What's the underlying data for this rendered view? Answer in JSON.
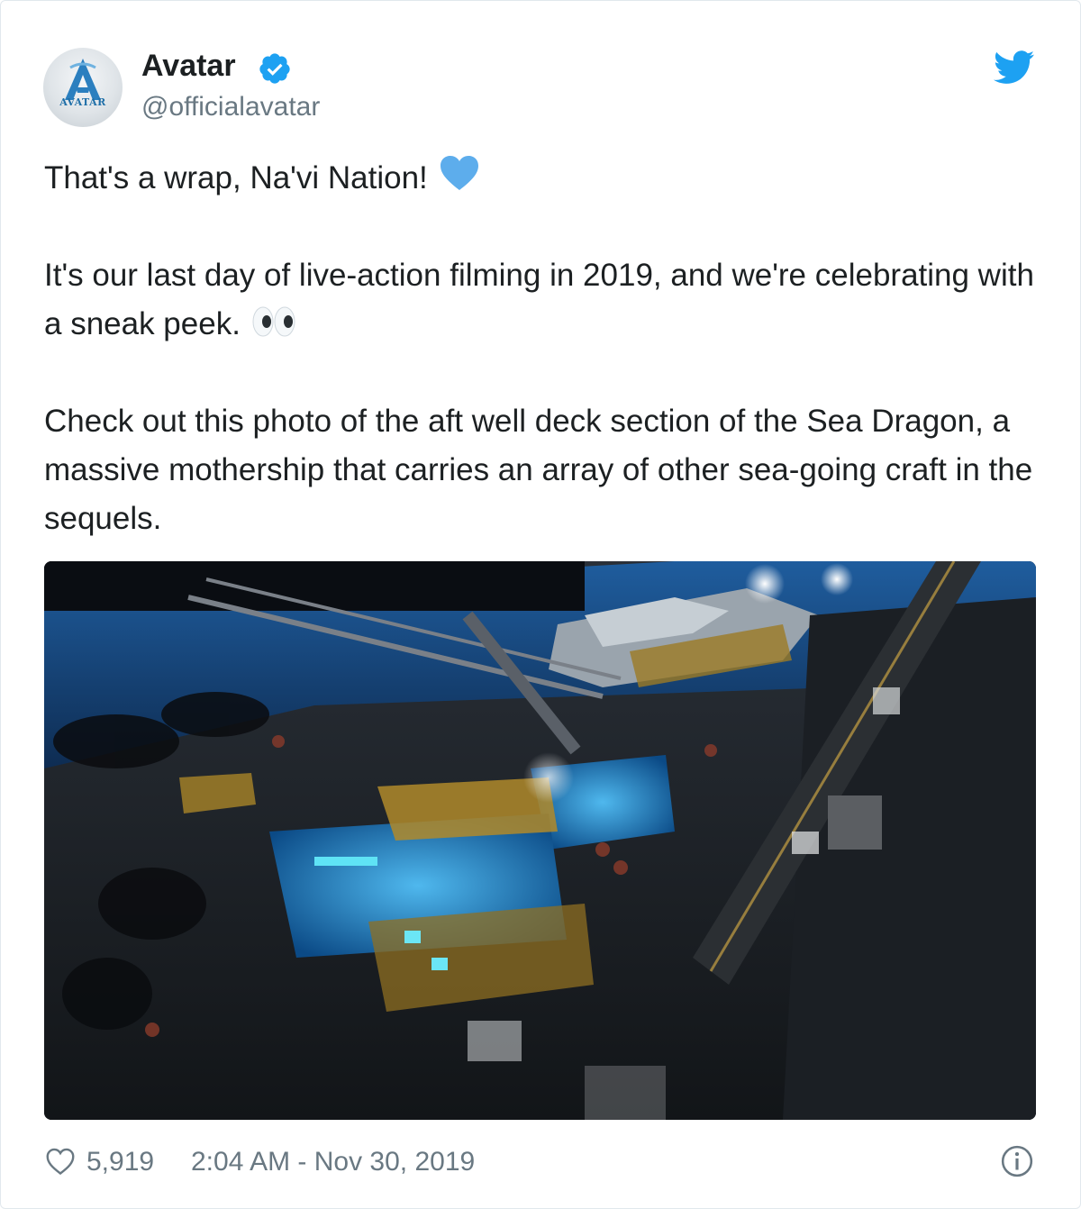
{
  "author": {
    "name": "Avatar",
    "handle": "@officialavatar",
    "logo_text": "AVATAR",
    "verified_icon": "verified-badge-icon",
    "verified_color": "#1da1f2"
  },
  "brand": {
    "icon": "twitter-bird-icon",
    "color": "#1da1f2"
  },
  "tweet": {
    "paragraphs": [
      "That's a wrap, Na'vi Nation!",
      "It's our last day of live-action filming in 2019, and we're celebrating with a sneak peek.",
      "Check out this photo of the aft well deck section of the Sea Dragon, a massive mothership that carries an array of other sea-going craft in the sequels."
    ],
    "emojis": [
      "blue-heart-icon",
      "eyes-icon"
    ]
  },
  "media": {
    "type": "photo",
    "subject": "film-set-photo"
  },
  "footer": {
    "like_icon": "heart-outline-icon",
    "likes": "5,919",
    "timestamp": "2:04 AM - Nov 30, 2019",
    "info_icon": "info-icon"
  },
  "colors": {
    "text": "#1c2022",
    "secondary": "#697882",
    "border": "#e1e8ed",
    "accent": "#1da1f2"
  }
}
